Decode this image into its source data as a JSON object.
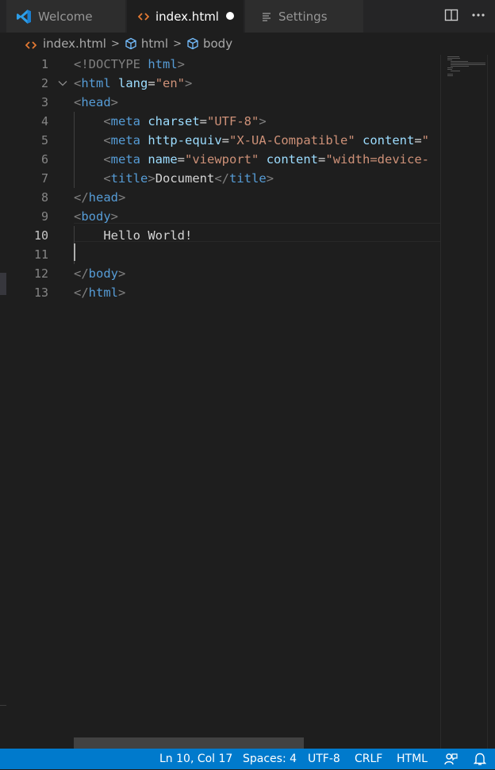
{
  "tabs": [
    {
      "label": "Welcome",
      "icon": "vscode-logo-icon",
      "active": false
    },
    {
      "label": "index.html",
      "icon": "html-file-icon",
      "active": true,
      "dirty": true
    },
    {
      "label": "Settings",
      "icon": "settings-editor-icon",
      "active": false
    }
  ],
  "tab_actions": [
    "split-editor-icon",
    "more-actions-icon"
  ],
  "breadcrumb": {
    "file": "index.html",
    "items": [
      "html",
      "body"
    ],
    "separator": ">"
  },
  "editor": {
    "line_numbers": [
      "1",
      "2",
      "3",
      "4",
      "5",
      "6",
      "7",
      "8",
      "9",
      "10",
      "11",
      "12",
      "13"
    ],
    "active_line": "10",
    "lines": [
      [
        [
          "<!DOCTYPE ",
          "br"
        ],
        [
          "html",
          "tag"
        ],
        [
          ">",
          "br"
        ]
      ],
      [
        [
          "<",
          "br"
        ],
        [
          "html",
          "tag"
        ],
        [
          " ",
          "txt"
        ],
        [
          "lang",
          "attr"
        ],
        [
          "=",
          "txt"
        ],
        [
          "\"en\"",
          "str"
        ],
        [
          ">",
          "br"
        ]
      ],
      [
        [
          "<",
          "br"
        ],
        [
          "head",
          "tag"
        ],
        [
          ">",
          "br"
        ]
      ],
      [
        [
          "    ",
          "txt"
        ],
        [
          "<",
          "br"
        ],
        [
          "meta",
          "tag"
        ],
        [
          " ",
          "txt"
        ],
        [
          "charset",
          "attr"
        ],
        [
          "=",
          "txt"
        ],
        [
          "\"UTF-8\"",
          "str"
        ],
        [
          ">",
          "br"
        ]
      ],
      [
        [
          "    ",
          "txt"
        ],
        [
          "<",
          "br"
        ],
        [
          "meta",
          "tag"
        ],
        [
          " ",
          "txt"
        ],
        [
          "http-equiv",
          "attr"
        ],
        [
          "=",
          "txt"
        ],
        [
          "\"X-UA-Compatible\"",
          "str"
        ],
        [
          " ",
          "txt"
        ],
        [
          "content",
          "attr"
        ],
        [
          "=",
          "txt"
        ],
        [
          "\"",
          "str"
        ]
      ],
      [
        [
          "    ",
          "txt"
        ],
        [
          "<",
          "br"
        ],
        [
          "meta",
          "tag"
        ],
        [
          " ",
          "txt"
        ],
        [
          "name",
          "attr"
        ],
        [
          "=",
          "txt"
        ],
        [
          "\"viewport\"",
          "str"
        ],
        [
          " ",
          "txt"
        ],
        [
          "content",
          "attr"
        ],
        [
          "=",
          "txt"
        ],
        [
          "\"width=device-",
          "str"
        ]
      ],
      [
        [
          "    ",
          "txt"
        ],
        [
          "<",
          "br"
        ],
        [
          "title",
          "tag"
        ],
        [
          ">",
          "br"
        ],
        [
          "Document",
          "txt"
        ],
        [
          "</",
          "br"
        ],
        [
          "title",
          "tag"
        ],
        [
          ">",
          "br"
        ]
      ],
      [
        [
          "</",
          "br"
        ],
        [
          "head",
          "tag"
        ],
        [
          ">",
          "br"
        ]
      ],
      [
        [
          "<",
          "br"
        ],
        [
          "body",
          "tag"
        ],
        [
          ">",
          "br"
        ]
      ],
      [
        [
          "    Hello World!",
          "txt"
        ]
      ],
      [
        [
          "",
          "txt"
        ]
      ],
      [
        [
          "</",
          "br"
        ],
        [
          "body",
          "tag"
        ],
        [
          ">",
          "br"
        ]
      ],
      [
        [
          "</",
          "br"
        ],
        [
          "html",
          "tag"
        ],
        [
          ">",
          "br"
        ]
      ]
    ]
  },
  "statusbar": {
    "position": "Ln 10, Col 17",
    "spaces": "Spaces: 4",
    "encoding": "UTF-8",
    "eol": "CRLF",
    "language": "HTML",
    "icons": [
      "feedback-icon",
      "notifications-bell-icon"
    ]
  },
  "colors": {
    "accent": "#007acc",
    "tag": "#569cd6",
    "attr": "#9cdcfe",
    "string": "#ce9178",
    "bracket": "#808080",
    "html_icon": "#e37933",
    "breadcrumb_icon": "#75beff"
  }
}
